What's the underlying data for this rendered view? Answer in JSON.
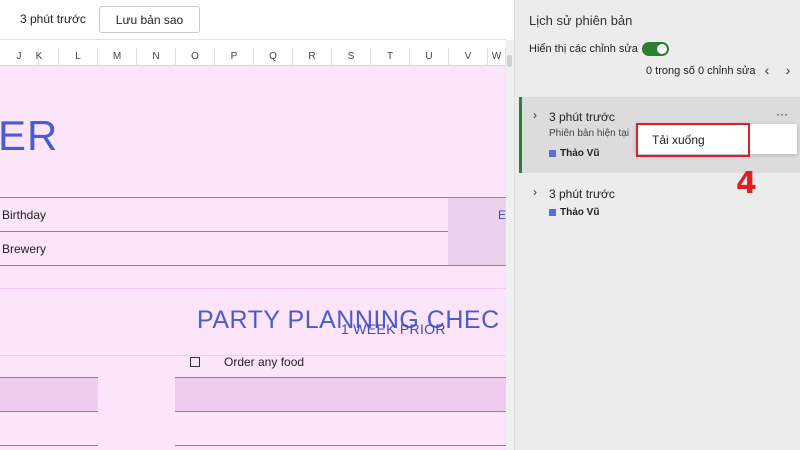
{
  "topbar": {
    "time_label": "3 phút trước",
    "save_copy_label": "Lưu bản sao"
  },
  "columns": [
    "J",
    "K",
    "L",
    "M",
    "N",
    "O",
    "P",
    "Q",
    "R",
    "S",
    "T",
    "U",
    "V",
    "W"
  ],
  "sheet": {
    "title_fragment": "ER",
    "row1_label": "Birthday",
    "row1_right_fragment": "E",
    "row2_label": "Brewery",
    "checklist_heading": "PARTY PLANNING CHEC",
    "week_header": "1 WEEK PRIOR",
    "checklist_item": "Order any food"
  },
  "panel": {
    "title": "Lịch sử phiên bản",
    "toggle_label": "Hiển thị các chỉnh sửa",
    "toggle_on": true,
    "edit_count": "0 trong số 0 chỉnh sửa",
    "prev_icon": "chevron-left-icon",
    "next_icon": "chevron-right-icon",
    "versions": [
      {
        "time": "3 phút trước",
        "subtitle": "Phiên bản hiện tại",
        "author": "Thảo Vũ"
      },
      {
        "time": "3 phút trước",
        "author": "Thảo Vũ"
      }
    ],
    "more_label": "···"
  },
  "context_menu": {
    "download_label": "Tải xuống"
  },
  "annotation": {
    "step": "4"
  },
  "colors": {
    "sheet_bg": "#fce4fa",
    "accent_blue": "#4b5bd0",
    "toggle_green": "#2e7d32",
    "highlight_red": "#e02020",
    "author_square": "#5a6fd6"
  }
}
